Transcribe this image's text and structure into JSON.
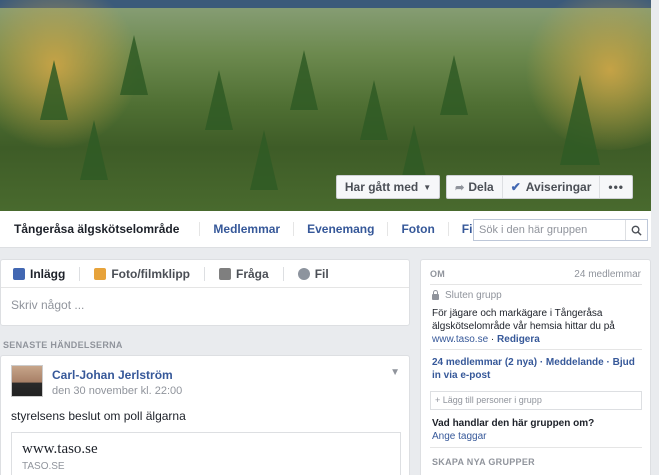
{
  "cover": {
    "joined_label": "Har gått med",
    "share_label": "Dela",
    "notifications_label": "Aviseringar",
    "more_label": "•••"
  },
  "tabs": {
    "group_name": "Tångeråsa älgskötselområde",
    "items": [
      "Medlemmar",
      "Evenemang",
      "Foton",
      "Filer"
    ]
  },
  "search": {
    "placeholder": "Sök i den här gruppen"
  },
  "composer": {
    "tabs": [
      "Inlägg",
      "Foto/filmklipp",
      "Fråga",
      "Fil"
    ],
    "placeholder": "Skriv något ..."
  },
  "feed": {
    "section_label": "SENASTE HÄNDELSERNA",
    "post": {
      "author": "Carl-Johan Jerlström",
      "time": "den 30 november kl. 22:00",
      "text": "styrelsens beslut om poll älgarna",
      "link_title": "www.taso.se",
      "link_domain": "TASO.SE"
    }
  },
  "about": {
    "heading": "OM",
    "member_count": "24 medlemmar",
    "privacy": "Sluten grupp",
    "description": "För jägare och markägare i Tångeråsa älgskötselområde vår hemsia hittar du på",
    "link": "www.taso.se",
    "edit": "Redigera",
    "members_line": "24 medlemmar (2 nya) · Meddelande · Bjud in via e-post",
    "add_people_placeholder": "+ Lägg till personer i grupp",
    "tags_question": "Vad handlar den här gruppen om?",
    "tags_link": "Ange taggar",
    "create_groups": "SKAPA NYA GRUPPER"
  },
  "colors": {
    "link_blue": "#365899",
    "background": "#e9ebee",
    "brand_blue": "#4267b2"
  }
}
